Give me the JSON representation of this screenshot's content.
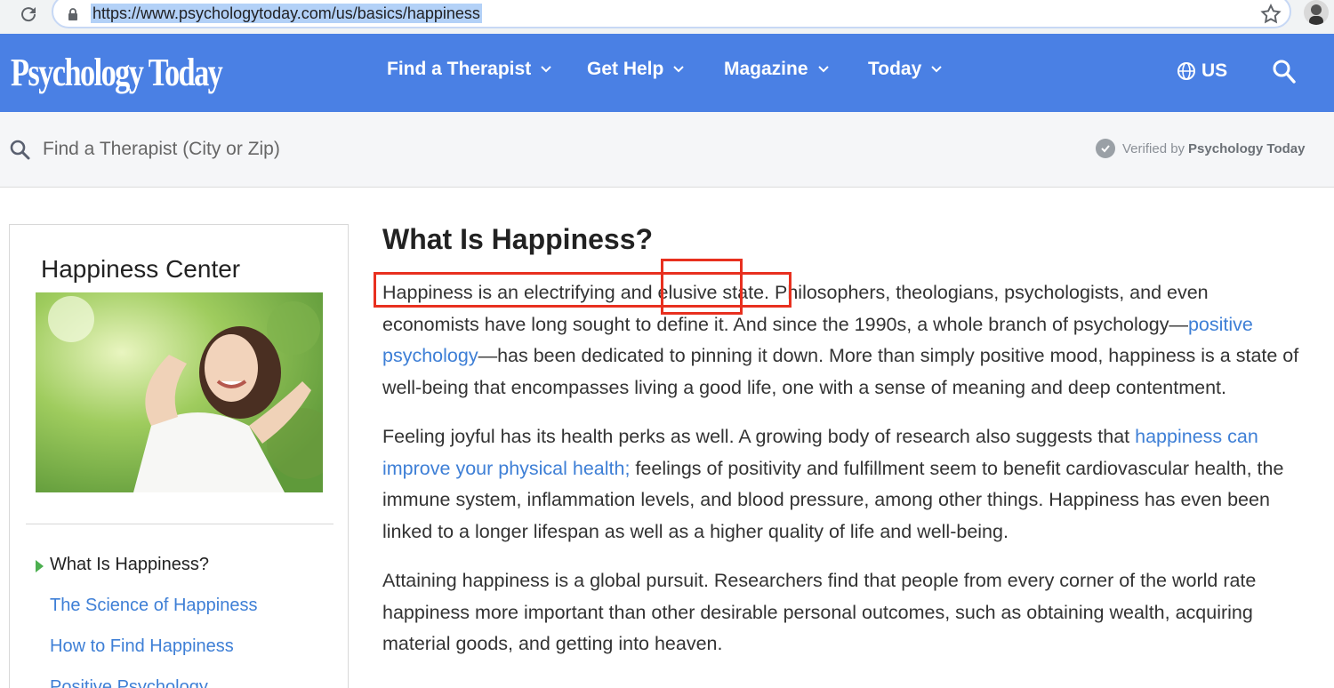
{
  "browser": {
    "url": "https://www.psychologytoday.com/us/basics/happiness"
  },
  "header": {
    "logo": "Psychology Today",
    "nav": [
      {
        "label": "Find a Therapist"
      },
      {
        "label": "Get Help"
      },
      {
        "label": "Magazine"
      },
      {
        "label": "Today"
      }
    ],
    "region": "US"
  },
  "find_bar": {
    "placeholder": "Find a Therapist (City or Zip)",
    "verified_prefix": "Verified by",
    "verified_brand": "Psychology Today"
  },
  "sidebar": {
    "title": "Happiness Center",
    "links": [
      {
        "label": "What Is Happiness?",
        "active": true
      },
      {
        "label": "The Science of Happiness",
        "active": false
      },
      {
        "label": "How to Find Happiness",
        "active": false
      },
      {
        "label": "Positive Psychology",
        "active": false
      }
    ]
  },
  "article": {
    "title": "What Is Happiness?",
    "p1": {
      "a": "Happiness is an electrifying and elusive state. Philosophers, theologians, psychologists, and even economists have long sought to define it. And since the 1990s, a whole branch of psychology—",
      "link": "positive psychology",
      "b": "—has been dedicated to pinning it down. More than simply positive mood, happiness is a state of well-being that encompasses living a good life, one with a sense of meaning and deep contentment."
    },
    "p2": {
      "a": "Feeling joyful has its health perks as well. A growing body of research also suggests that ",
      "link": "happiness can improve your physical health;",
      "b": " feelings of positivity and fulfillment seem to benefit cardiovascular health, the immune system, inflammation levels, and blood pressure, among other things. Happiness has even been linked to a longer lifespan as well as a higher quality of life and well-being."
    },
    "p3": "Attaining happiness is a global pursuit. Researchers find that people from every corner of the world rate happiness more important than other desirable personal outcomes, such as obtaining wealth, acquiring material goods, and getting into heaven."
  },
  "colors": {
    "brand_blue": "#4a80e4",
    "link_blue": "#3e7fd6",
    "annotation_red": "#e8301f"
  }
}
